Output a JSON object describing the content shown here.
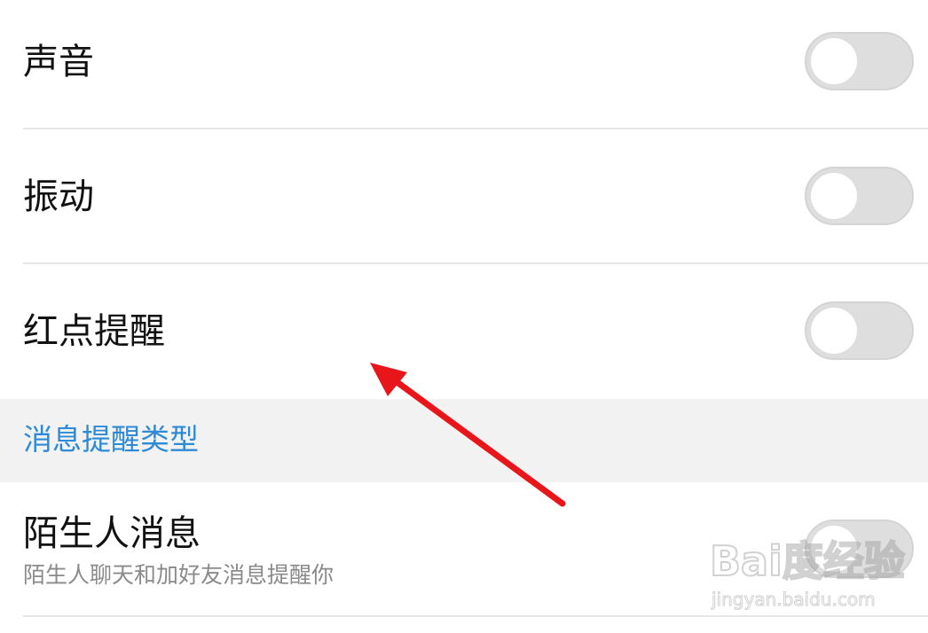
{
  "settings": {
    "sound": {
      "label": "声音",
      "enabled": false
    },
    "vibration": {
      "label": "振动",
      "enabled": false
    },
    "red_dot": {
      "label": "红点提醒",
      "enabled": false
    }
  },
  "section": {
    "title": "消息提醒类型"
  },
  "stranger": {
    "label": "陌生人消息",
    "description": "陌生人聊天和加好友消息提醒你",
    "enabled": false
  },
  "watermark": {
    "main": "Bai度经验",
    "sub": "jingyan.baidu.com"
  },
  "colors": {
    "section_text": "#2d8ad6",
    "section_bg": "#f2f2f2",
    "toggle_off": "#dedede",
    "arrow": "#e8161b"
  }
}
